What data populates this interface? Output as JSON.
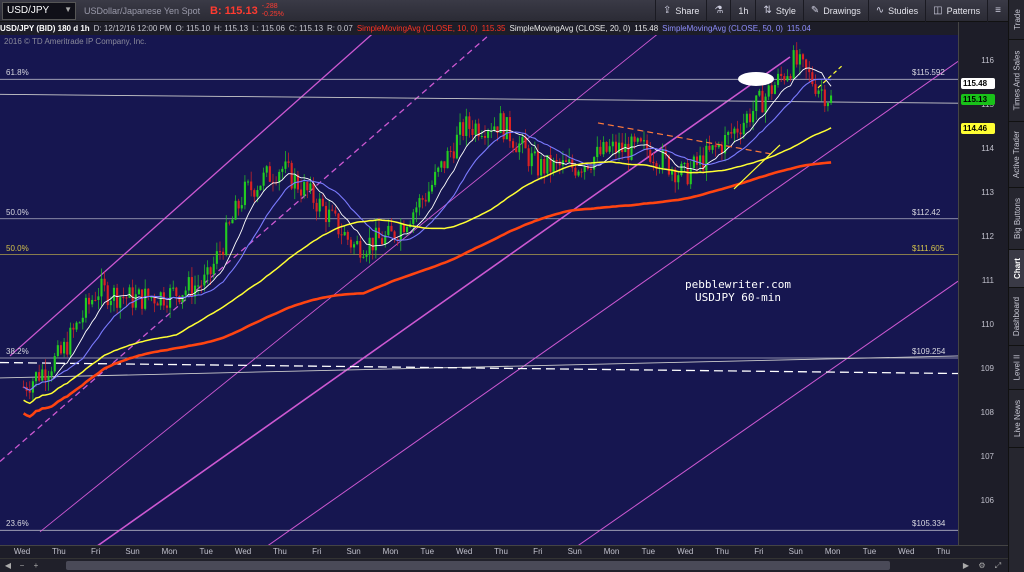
{
  "toolbar": {
    "symbol": "USD/JPY",
    "description": "USDollar/Japanese Yen Spot",
    "bid_label": "B: 115.13",
    "change_abs": "-.288",
    "change_pct": "-0.25%",
    "share": "Share",
    "interval": "1h",
    "style": "Style",
    "drawings": "Drawings",
    "studies": "Studies",
    "patterns": "Patterns",
    "icons": {
      "share": "share-icon",
      "flask": "flask-icon",
      "style": "style-icon",
      "drawings": "pencil-icon",
      "studies": "studies-icon",
      "patterns": "patterns-icon"
    }
  },
  "study_line": {
    "main": "USD/JPY (BID) 180 d 1h",
    "date": "D: 12/12/16 12:00 PM",
    "open": "O: 115.10",
    "high": "H: 115.13",
    "low": "L: 115.06",
    "close": "C: 115.13",
    "range": "R: 0.07",
    "sma10": "SimpleMovingAvg (CLOSE, 10, 0)",
    "sma10_val": "115.35",
    "sma20": "SimpleMovingAvg (CLOSE, 20, 0)",
    "sma20_val": "115.48",
    "sma50": "SimpleMovingAvg (CLOSE, 50, 0)",
    "sma50_val": "115.04"
  },
  "copyright": "2016 © TD Ameritrade IP Company, Inc.",
  "annotation": {
    "line1": "pebblewriter.com",
    "line2": "USDJPY 60-min"
  },
  "fib_labels": [
    {
      "text": "61.8%",
      "price": 115.592,
      "color": "#d8d8e0"
    },
    {
      "text": "50.0%",
      "price": 112.42,
      "color": "#d8d8e0"
    },
    {
      "text": "50.0%",
      "price": 111.605,
      "color": "#d4c24a"
    },
    {
      "text": "38.2%",
      "price": 109.254,
      "color": "#d8d8e0"
    },
    {
      "text": "23.6%",
      "price": 105.334,
      "color": "#d8d8e0"
    }
  ],
  "level_labels": [
    {
      "text": "$115.592",
      "price": 115.592,
      "color": "#d8d8e0"
    },
    {
      "text": "$112.42",
      "price": 112.42,
      "color": "#d8d8e0"
    },
    {
      "text": "$111.605",
      "price": 111.605,
      "color": "#d4c24a"
    },
    {
      "text": "$109.254",
      "price": 109.254,
      "color": "#d8d8e0"
    },
    {
      "text": "$105.334",
      "price": 105.334,
      "color": "#d8d8e0"
    }
  ],
  "price_tags": [
    {
      "text": "115.48",
      "price": 115.48,
      "bg": "#ffffff",
      "fg": "#000000"
    },
    {
      "text": "115.13",
      "price": 115.13,
      "bg": "#19c219",
      "fg": "#000000"
    },
    {
      "text": "114.46",
      "price": 114.46,
      "bg": "#ffff33",
      "fg": "#000000"
    }
  ],
  "price_ticks": [
    "116",
    "115",
    "114",
    "113",
    "112",
    "111",
    "110",
    "109",
    "108",
    "107",
    "106"
  ],
  "time_labels": [
    "Wed",
    "Thu",
    "Fri",
    "Sun",
    "Mon",
    "Tue",
    "Wed",
    "Thu",
    "Fri",
    "Sun",
    "Mon",
    "Tue",
    "Wed",
    "Thu",
    "Fri",
    "Sun",
    "Mon",
    "Tue",
    "Wed",
    "Thu",
    "Fri",
    "Sun",
    "Mon",
    "Tue",
    "Wed",
    "Thu"
  ],
  "side_tabs": [
    "Trade",
    "Times And Sales",
    "Active Trader",
    "Big Buttons",
    "Chart",
    "Dashboard",
    "Level II",
    "Live News"
  ],
  "colors": {
    "background": "#161650",
    "sma10": "#ffffff",
    "sma20": "#7b7bff",
    "sma50": "#ffff33",
    "sma200": "#ff4411",
    "channel": "#e060e0",
    "up_candle": "#22cc22",
    "down_candle": "#dd2222"
  },
  "chart_data": {
    "type": "candlestick",
    "title": "USD/JPY (BID) 180 d 1h",
    "ylim": [
      105,
      116.6
    ],
    "x_categories": [
      "Wed",
      "Thu",
      "Fri",
      "Sun",
      "Mon",
      "Tue",
      "Wed",
      "Thu",
      "Fri",
      "Sun",
      "Mon",
      "Tue",
      "Wed",
      "Thu",
      "Fri",
      "Sun",
      "Mon",
      "Tue",
      "Wed",
      "Thu",
      "Fri",
      "Sun",
      "Mon",
      "Tue",
      "Wed",
      "Thu"
    ],
    "price_path": [
      [
        0,
        108.6
      ],
      [
        1,
        109.3
      ],
      [
        2,
        110.8
      ],
      [
        3,
        110.6
      ],
      [
        4,
        110.7
      ],
      [
        5,
        111.0
      ],
      [
        6,
        113.0
      ],
      [
        7,
        113.6
      ],
      [
        8,
        112.8
      ],
      [
        9,
        111.8
      ],
      [
        10,
        112.0
      ],
      [
        11,
        113.0
      ],
      [
        12,
        114.5
      ],
      [
        13,
        114.6
      ],
      [
        14,
        113.6
      ],
      [
        15,
        113.6
      ],
      [
        16,
        114.0
      ],
      [
        17,
        114.0
      ],
      [
        18,
        113.4
      ],
      [
        19,
        114.1
      ],
      [
        20,
        115.0
      ],
      [
        21,
        116.0
      ],
      [
        22,
        115.13
      ]
    ],
    "series": [
      {
        "name": "SimpleMovingAvg (CLOSE, 10, 0)",
        "value": 115.35
      },
      {
        "name": "SimpleMovingAvg (CLOSE, 20, 0)",
        "value": 115.48
      },
      {
        "name": "SimpleMovingAvg (CLOSE, 50, 0)",
        "value": 115.04
      }
    ],
    "last_close": 115.13
  }
}
